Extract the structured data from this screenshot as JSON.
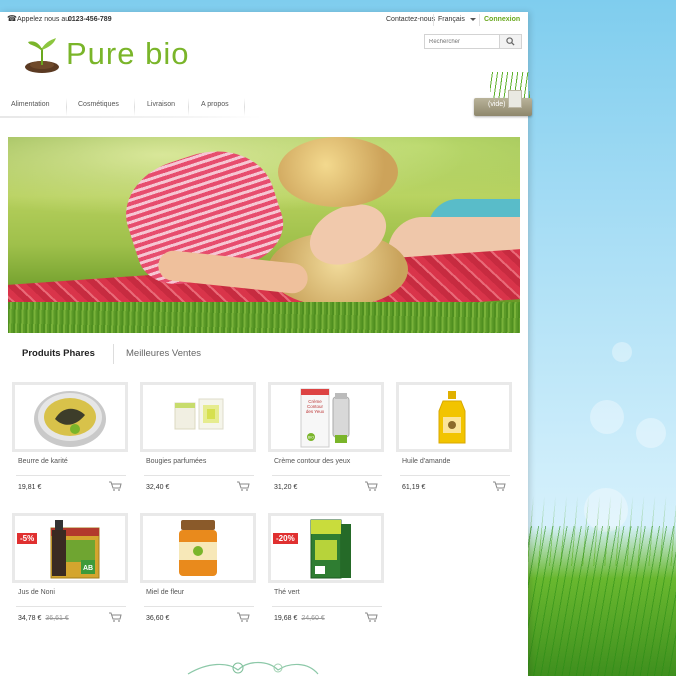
{
  "header": {
    "call_label": "Appelez nous au :",
    "phone_number": "0123-456-789",
    "contact_link": "Contactez-nous",
    "language": "Français",
    "login": "Connexion",
    "search_placeholder": "Rechercher"
  },
  "logo": {
    "text": "Pure bio"
  },
  "nav": {
    "items": [
      {
        "label": "Alimentation"
      },
      {
        "label": "Cosmétiques"
      },
      {
        "label": "Livraison"
      },
      {
        "label": "A propos"
      }
    ]
  },
  "cart": {
    "label": "(vide)"
  },
  "tabs": {
    "active": "Produits Phares",
    "other": "Meilleures Ventes"
  },
  "products": [
    {
      "name": "Beurre de karité",
      "price": "19,81 €",
      "old_price": "",
      "discount": ""
    },
    {
      "name": "Bougies parfumées",
      "price": "32,40 €",
      "old_price": "",
      "discount": ""
    },
    {
      "name": "Crème contour des yeux",
      "price": "31,20 €",
      "old_price": "",
      "discount": "",
      "image_text": "Crème Contour des Yeux",
      "badge": "BIO"
    },
    {
      "name": "Huile d'amande",
      "price": "61,19 €",
      "old_price": "",
      "discount": ""
    },
    {
      "name": "Jus de Noni",
      "price": "34,78 €",
      "old_price": "36,61 €",
      "discount": "-5%",
      "badge": "AB"
    },
    {
      "name": "Miel de fleur",
      "price": "36,60 €",
      "old_price": "",
      "discount": ""
    },
    {
      "name": "Thé vert",
      "price": "19,68 €",
      "old_price": "24,60 €",
      "discount": "-20%"
    }
  ],
  "colors": {
    "brand_green": "#7ab52a",
    "link_green": "#6aa81e",
    "discount_red": "#e03030"
  }
}
